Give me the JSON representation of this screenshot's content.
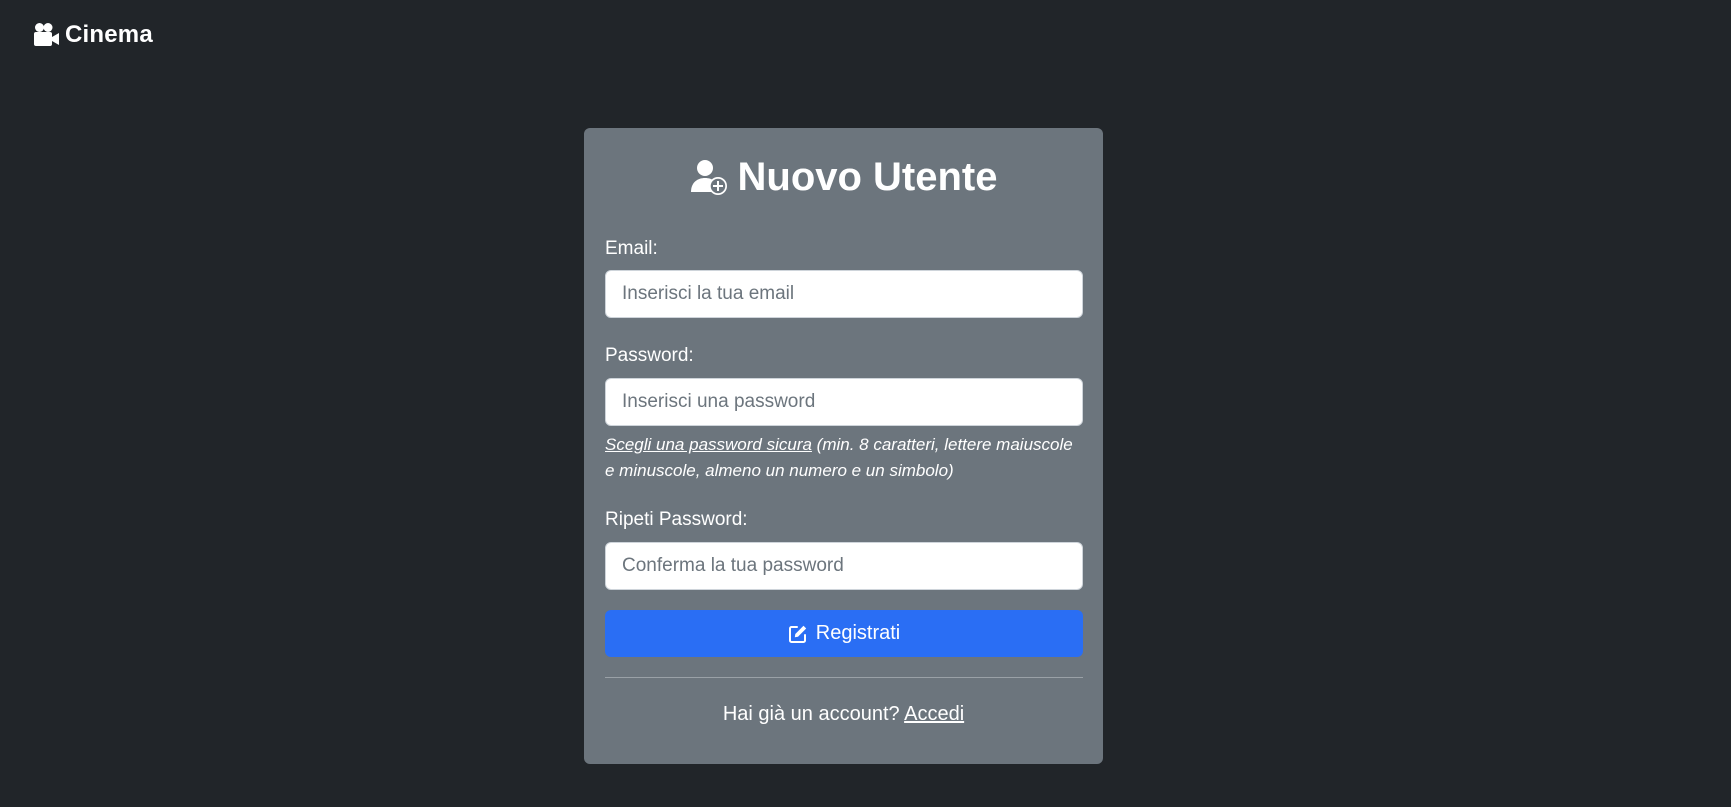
{
  "navbar": {
    "brand_icon": "video-camera-icon",
    "brand_label": "Cinema"
  },
  "card": {
    "title_icon": "user-plus-icon",
    "title": "Nuovo Utente",
    "email": {
      "label": "Email:",
      "placeholder": "Inserisci la tua email",
      "value": ""
    },
    "password": {
      "label": "Password:",
      "placeholder": "Inserisci una password",
      "value": "",
      "help_link": "Scegli una password sicura",
      "help_text": " (min. 8 caratteri, lettere maiuscole e minuscole, almeno un numero e un simbolo)"
    },
    "confirm_password": {
      "label": "Ripeti Password:",
      "placeholder": "Conferma la tua password",
      "value": ""
    },
    "submit": {
      "icon": "edit-icon",
      "label": "Registrati"
    },
    "footer": {
      "question": "Hai già un account? ",
      "link": "Accedi"
    }
  },
  "colors": {
    "page_background": "#212529",
    "card_background": "#6c757d",
    "primary_button": "#2a6ef4",
    "text": "#ffffff"
  }
}
